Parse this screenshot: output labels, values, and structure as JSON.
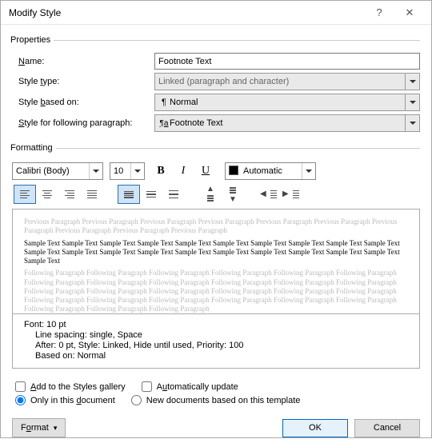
{
  "window": {
    "title": "Modify Style"
  },
  "properties": {
    "legend": "Properties",
    "name_label_pre": "",
    "name_key": "N",
    "name_label_post": "ame:",
    "name_value": "Footnote Text",
    "type_label": "Style type:",
    "type_key": "t",
    "type_value": "Linked (paragraph and character)",
    "based_label_pre": "Style ",
    "based_key": "b",
    "based_label_post": "ased on:",
    "based_value": "Normal",
    "following_label_pre": "Style for following paragraph:",
    "following_key": "s",
    "following_value": "Footnote Text"
  },
  "formatting": {
    "legend": "Formatting",
    "font": "Calibri (Body)",
    "size": "10",
    "color": "Automatic",
    "preview_ghost_prev": "Previous Paragraph Previous Paragraph Previous Paragraph Previous Paragraph Previous Paragraph Previous Paragraph Previous Paragraph Previous Paragraph Previous Paragraph Previous Paragraph",
    "preview_sample": "Sample Text Sample Text Sample Text Sample Text Sample Text Sample Text Sample Text Sample Text Sample Text Sample Text Sample Text Sample Text Sample Text Sample Text Sample Text Sample Text Sample Text Sample Text Sample Text Sample Text Sample Text",
    "preview_ghost_next": "Following Paragraph Following Paragraph Following Paragraph Following Paragraph Following Paragraph Following Paragraph Following Paragraph Following Paragraph Following Paragraph Following Paragraph Following Paragraph Following Paragraph Following Paragraph Following Paragraph Following Paragraph Following Paragraph Following Paragraph Following Paragraph Following Paragraph Following Paragraph Following Paragraph Following Paragraph Following Paragraph Following Paragraph Following Paragraph Following Paragraph Following Paragraph"
  },
  "description": {
    "line1": "Font: 10 pt",
    "line2": "Line spacing:  single, Space",
    "line3": "After:  0 pt, Style: Linked, Hide until used, Priority: 100",
    "line4": "Based on: Normal"
  },
  "options": {
    "add_gallery_pre": "A",
    "add_gallery_post": "dd to the Styles gallery",
    "auto_update_pre": "A",
    "auto_update_key": "u",
    "auto_update_post": "tomatically update",
    "only_doc": "Only in this document",
    "only_key": "d",
    "new_docs": "New documents based on this template"
  },
  "footer": {
    "format_label": "Format",
    "format_key": "o",
    "ok": "OK",
    "cancel": "Cancel"
  }
}
